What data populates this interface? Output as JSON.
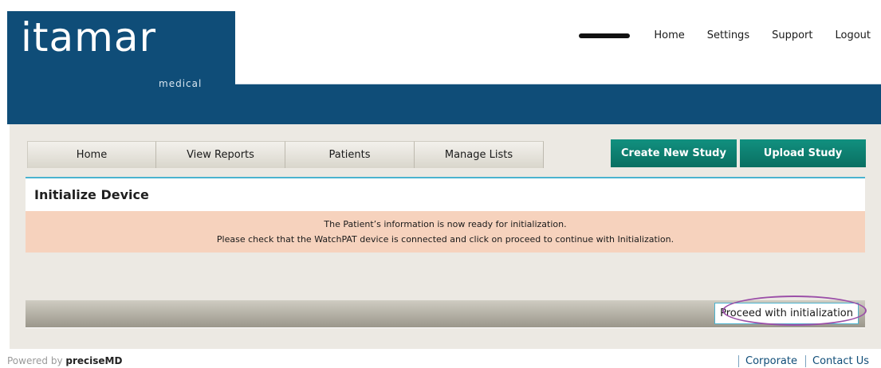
{
  "brand": {
    "name": "itamar",
    "sub": "medical"
  },
  "topnav": {
    "items": [
      "Home",
      "Settings",
      "Support",
      "Logout"
    ]
  },
  "tabs": [
    "Home",
    "View Reports",
    "Patients",
    "Manage Lists"
  ],
  "actions": {
    "create": "Create New Study",
    "upload": "Upload Study"
  },
  "panel": {
    "title": "Initialize Device",
    "notice_line1": "The Patient’s information is now ready for initialization.",
    "notice_line2": "Please check that the WatchPAT device is connected and click on proceed to continue with Initialization.",
    "proceed": "Proceed with initialization"
  },
  "footer": {
    "powered_by": "Powered by",
    "powered_name": "preciseMD",
    "links": [
      "Corporate",
      "Contact Us"
    ]
  },
  "colors": {
    "brand_blue": "#0f4d78",
    "green": "#0a6f62",
    "notice_bg": "#f6d2bd",
    "accent": "#4ab3cf",
    "highlight": "#9b4fa8"
  }
}
